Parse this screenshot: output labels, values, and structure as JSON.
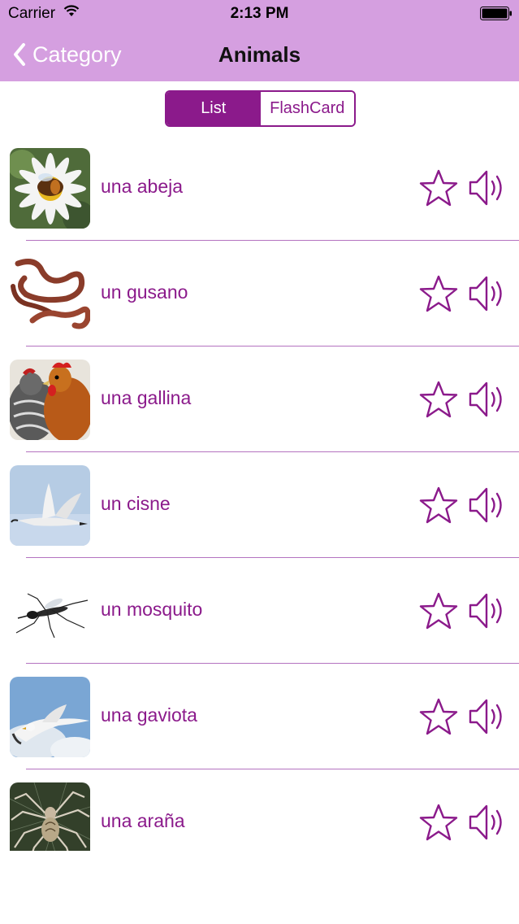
{
  "status_bar": {
    "carrier": "Carrier",
    "time": "2:13 PM"
  },
  "nav": {
    "back_label": "Category",
    "title": "Animals"
  },
  "view_toggle": {
    "options": [
      "List",
      "FlashCard"
    ],
    "selected": "List"
  },
  "colors": {
    "header": "#d59fe0",
    "accent": "#8b1a8b",
    "separator": "#b473c0"
  },
  "words": [
    {
      "text": "una abeja",
      "image": "bee-photo"
    },
    {
      "text": "un gusano",
      "image": "worm-photo"
    },
    {
      "text": "una gallina",
      "image": "chicken-photo"
    },
    {
      "text": "un cisne",
      "image": "swan-photo"
    },
    {
      "text": "un mosquito",
      "image": "mosquito-photo"
    },
    {
      "text": "una gaviota",
      "image": "seagull-photo"
    },
    {
      "text": "una araña",
      "image": "spider-photo"
    }
  ]
}
